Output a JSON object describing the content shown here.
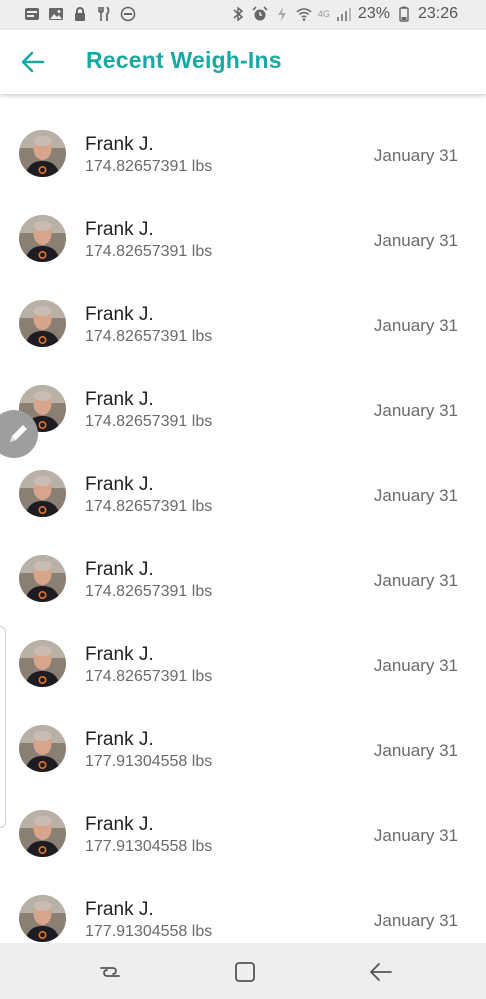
{
  "status_bar": {
    "battery": "23%",
    "time": "23:26",
    "network": "4G"
  },
  "header": {
    "title": "Recent Weigh-Ins",
    "accent_color": "#17a9a3"
  },
  "weigh_ins": [
    {
      "name": "Frank J.",
      "weight": "174.82657391 lbs",
      "date": "January 31"
    },
    {
      "name": "Frank J.",
      "weight": "174.82657391 lbs",
      "date": "January 31"
    },
    {
      "name": "Frank J.",
      "weight": "174.82657391 lbs",
      "date": "January 31"
    },
    {
      "name": "Frank J.",
      "weight": "174.82657391 lbs",
      "date": "January 31"
    },
    {
      "name": "Frank J.",
      "weight": "174.82657391 lbs",
      "date": "January 31"
    },
    {
      "name": "Frank J.",
      "weight": "174.82657391 lbs",
      "date": "January 31"
    },
    {
      "name": "Frank J.",
      "weight": "174.82657391 lbs",
      "date": "January 31"
    },
    {
      "name": "Frank J.",
      "weight": "177.91304558 lbs",
      "date": "January 31"
    },
    {
      "name": "Frank J.",
      "weight": "177.91304558 lbs",
      "date": "January 31"
    },
    {
      "name": "Frank J.",
      "weight": "177.91304558 lbs",
      "date": "January 31"
    }
  ],
  "icons": {
    "back": "arrow-left-icon",
    "edit": "pencil-icon",
    "nav_recent": "recent-apps-icon",
    "nav_home": "home-icon",
    "nav_back": "back-icon"
  }
}
